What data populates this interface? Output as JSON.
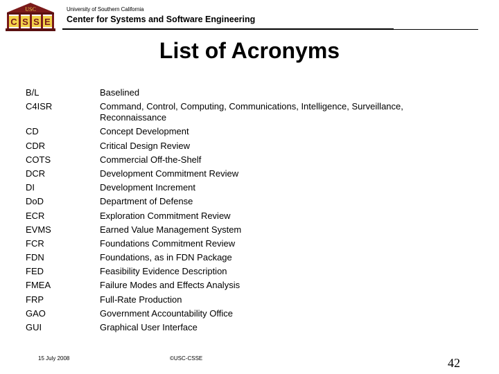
{
  "header": {
    "logo": {
      "roof_text": "USC",
      "column_letters": [
        "C",
        "S",
        "S",
        "E"
      ],
      "colors": {
        "maroon": "#7a1a1a",
        "gold": "#f2d24a",
        "dark": "#3a0c0c"
      }
    },
    "university": "University of Southern California",
    "center": "Center for Systems and Software Engineering"
  },
  "slide": {
    "title": "List of Acronyms",
    "acronyms": [
      {
        "abbr": "B/L",
        "definition": "Baselined"
      },
      {
        "abbr": "C4ISR",
        "definition": "Command, Control, Computing, Communications, Intelligence, Surveillance, Reconnaissance"
      },
      {
        "abbr": "CD",
        "definition": "Concept Development"
      },
      {
        "abbr": "CDR",
        "definition": "Critical Design Review"
      },
      {
        "abbr": "COTS",
        "definition": "Commercial Off-the-Shelf"
      },
      {
        "abbr": "DCR",
        "definition": "Development Commitment Review"
      },
      {
        "abbr": "DI",
        "definition": "Development Increment"
      },
      {
        "abbr": "DoD",
        "definition": "Department of Defense"
      },
      {
        "abbr": "ECR",
        "definition": "Exploration Commitment Review"
      },
      {
        "abbr": "EVMS",
        "definition": "Earned Value Management System"
      },
      {
        "abbr": "FCR",
        "definition": "Foundations Commitment Review"
      },
      {
        "abbr": "FDN",
        "definition": "Foundations, as in FDN Package"
      },
      {
        "abbr": "FED",
        "definition": "Feasibility Evidence Description"
      },
      {
        "abbr": "FMEA",
        "definition": "Failure Modes and Effects Analysis"
      },
      {
        "abbr": "FRP",
        "definition": "Full-Rate Production"
      },
      {
        "abbr": "GAO",
        "definition": "Government Accountability Office"
      },
      {
        "abbr": "GUI",
        "definition": "Graphical User Interface"
      }
    ]
  },
  "footer": {
    "date": "15 July 2008",
    "copyright": "©USC-CSSE",
    "page_number": "42"
  }
}
